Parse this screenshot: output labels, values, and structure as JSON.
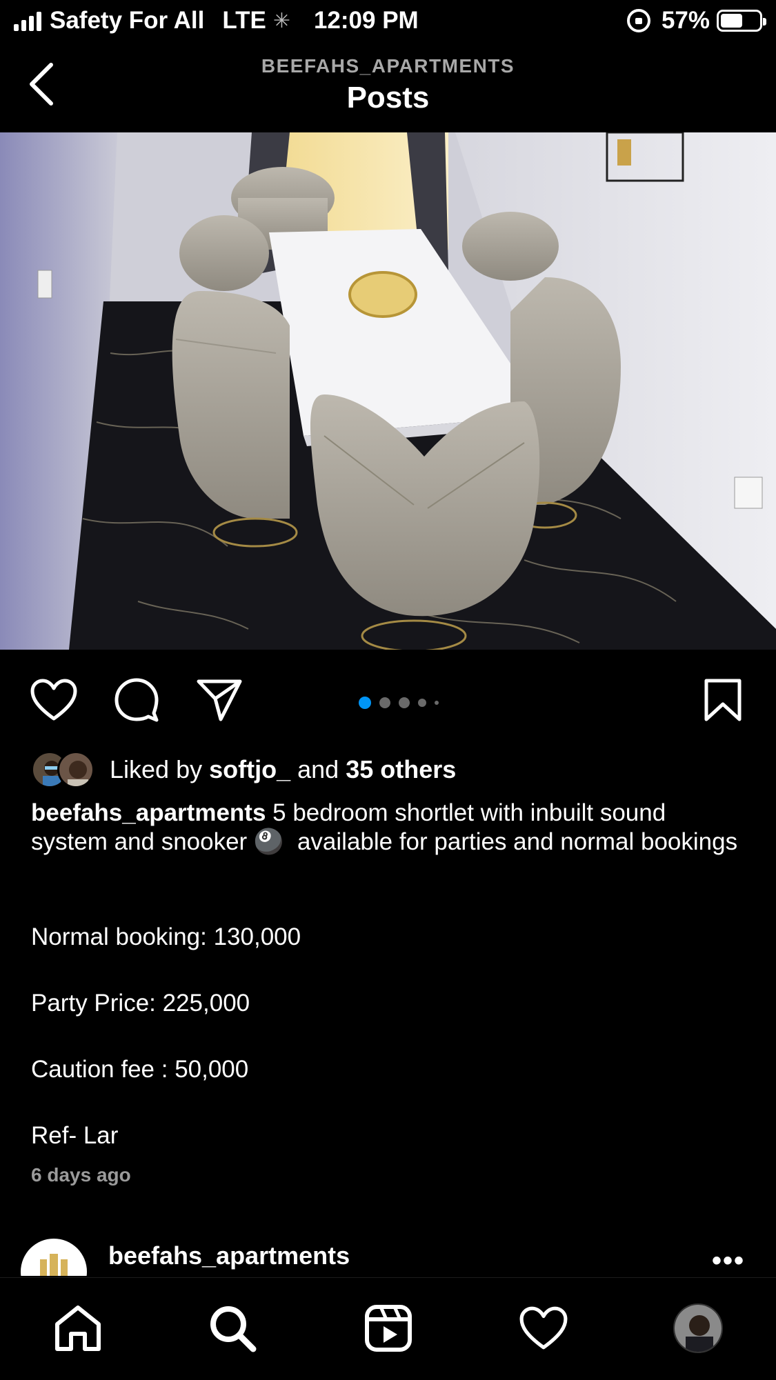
{
  "status_bar": {
    "carrier": "Safety For All",
    "network": "LTE",
    "time": "12:09 PM",
    "battery": "57%",
    "battery_level": 0.57
  },
  "header": {
    "account": "BEEFAHS_APARTMENTS",
    "title": "Posts"
  },
  "post": {
    "carousel": {
      "count": 5,
      "active_index": 0
    },
    "likes": {
      "prefix": "Liked by",
      "first_user": "softjo_",
      "connector": "and",
      "others": "35 others"
    },
    "caption": {
      "username": "beefahs_apartments",
      "text": "5 bedroom shortlet with inbuilt sound system and snooker 🎱  available for parties and normal bookings",
      "lines": [
        "Normal booking: 130,000",
        "Party Price: 225,000",
        "Caution fee : 50,000",
        "Ref- Lar"
      ]
    },
    "time_ago": "6 days ago"
  },
  "next_post": {
    "username": "beefahs_apartments",
    "more": "•••"
  },
  "icons": {
    "back": "chevron-left-icon",
    "like": "heart-icon",
    "comment": "comment-icon",
    "share": "paper-plane-icon",
    "save": "bookmark-icon",
    "home": "home-icon",
    "search": "search-icon",
    "reels": "reels-icon",
    "activity": "heart-icon",
    "profile": "profile-avatar"
  },
  "colors": {
    "background": "#000000",
    "text": "#ffffff",
    "muted": "#a8a8a8",
    "accent_dot": "#0095f6"
  }
}
